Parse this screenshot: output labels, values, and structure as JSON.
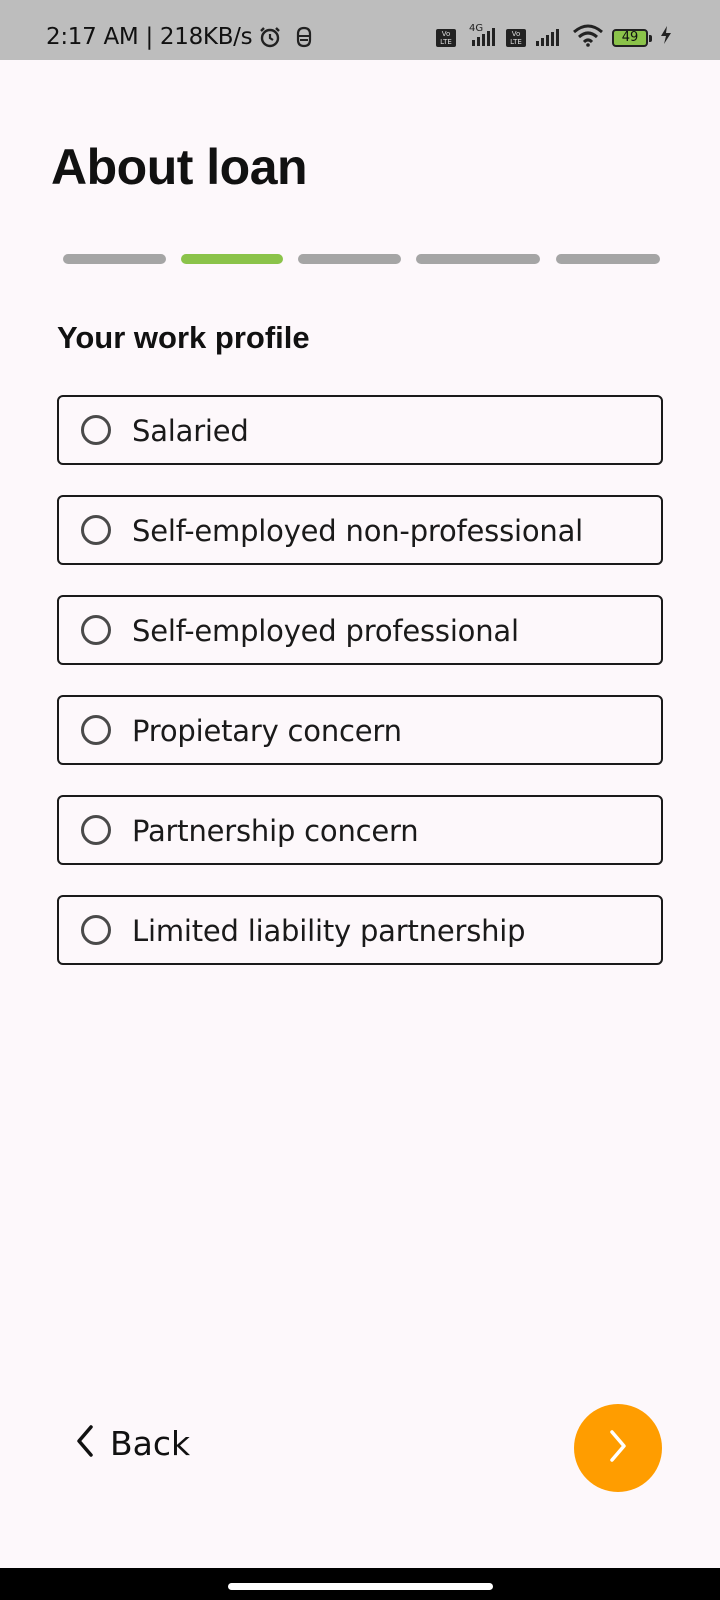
{
  "status_bar": {
    "time": "2:17 AM | 218KB/s",
    "network_label": "4G",
    "volte_label": "Vo LTE",
    "battery_level": "49"
  },
  "header": {
    "title": "About loan"
  },
  "progress": {
    "total_steps": 5,
    "current_step": 2,
    "active_color": "#8bc34a",
    "inactive_color": "#a5a5a5"
  },
  "form": {
    "section_heading": "Your work profile",
    "options": [
      {
        "label": "Salaried",
        "selected": false
      },
      {
        "label": "Self-employed non-professional",
        "selected": false
      },
      {
        "label": "Self-employed professional",
        "selected": false
      },
      {
        "label": "Propietary concern",
        "selected": false
      },
      {
        "label": "Partnership concern",
        "selected": false
      },
      {
        "label": "Limited liability partnership",
        "selected": false
      }
    ]
  },
  "footer": {
    "back_label": "Back",
    "back_icon": "chevron-left-icon",
    "next_icon": "chevron-right-icon",
    "next_color": "#ff9d00"
  }
}
